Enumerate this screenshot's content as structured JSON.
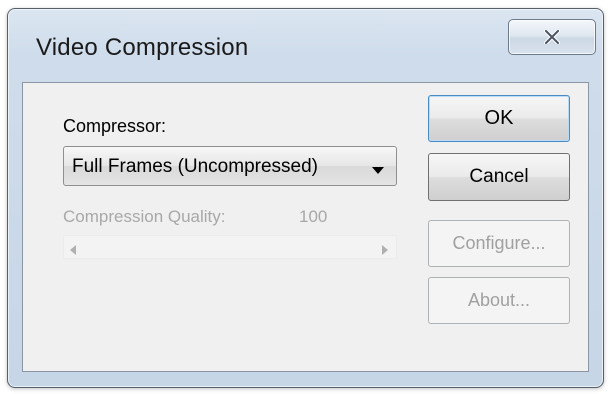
{
  "window": {
    "title": "Video Compression",
    "close_tooltip": "Close"
  },
  "compressor": {
    "label": "Compressor:",
    "selected": "Full Frames (Uncompressed)"
  },
  "quality": {
    "label": "Compression Quality:",
    "value": "100"
  },
  "buttons": {
    "ok": "OK",
    "cancel": "Cancel",
    "configure": "Configure...",
    "about": "About..."
  },
  "icons": {
    "close": "close-icon",
    "dropdown": "chevron-down-icon",
    "slider_left": "arrow-left-icon",
    "slider_right": "arrow-right-icon"
  },
  "colors": {
    "window_frame": "#c6d6e7",
    "client_bg": "#f0f0f0",
    "disabled_text": "#a8a8a8",
    "default_button_border": "#4a8bc2"
  }
}
